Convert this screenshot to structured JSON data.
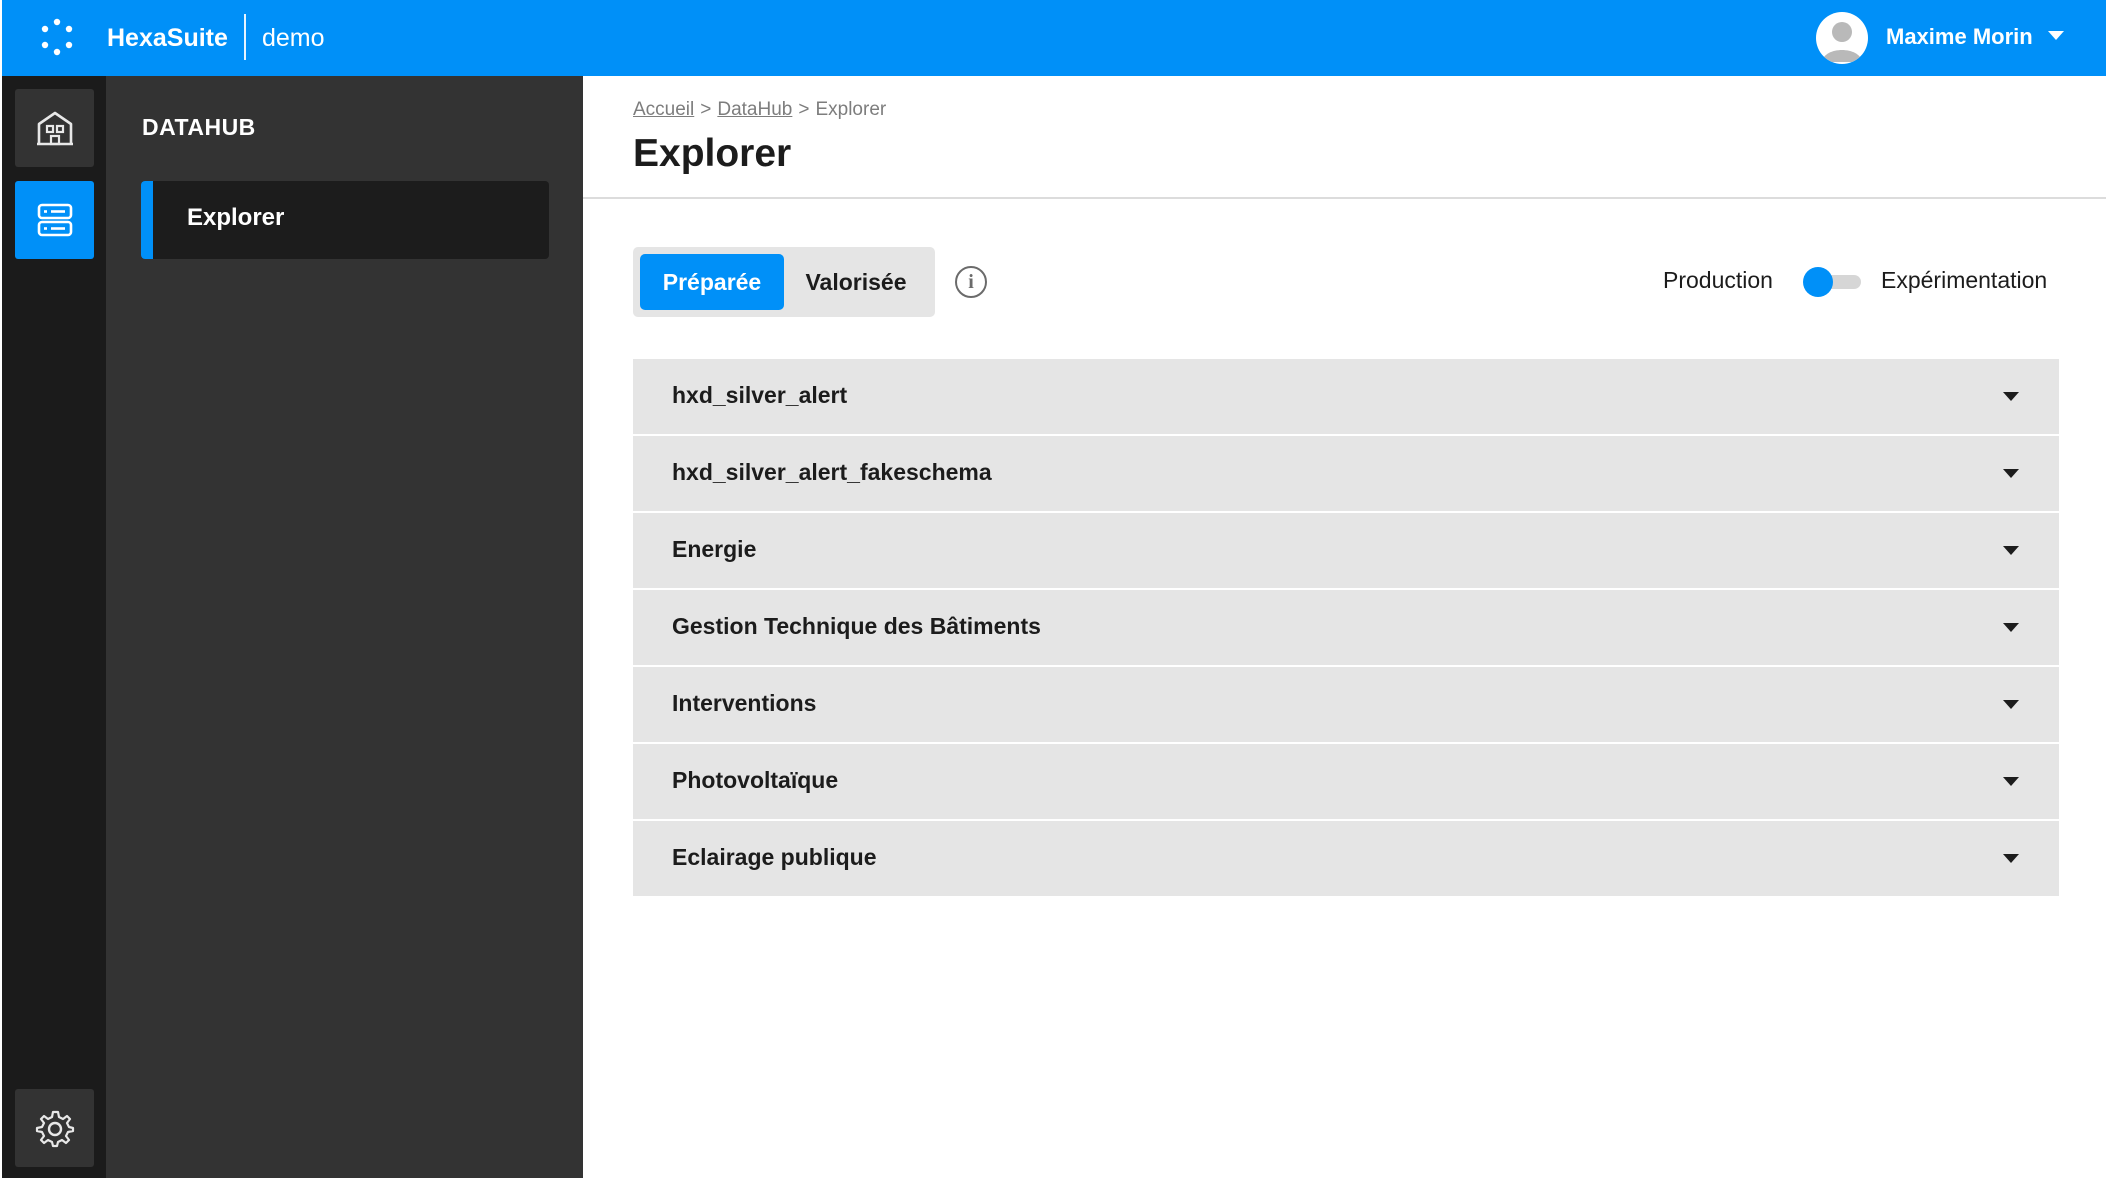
{
  "app": {
    "brand": "HexaSuite",
    "environment": "demo",
    "colors": {
      "primary": "#0090f8",
      "rail": "#1b1b1b",
      "sidebar": "#333333",
      "panel": "#e5e5e5"
    }
  },
  "user": {
    "name": "Maxime Morin"
  },
  "icons": {
    "logo": "dots-circle-icon",
    "rail_buildings": "building-icon",
    "rail_datahub": "server-stack-icon",
    "rail_settings": "gear-icon",
    "user_menu": "chevron-down-icon",
    "info": "info-circle-icon",
    "row_expand": "caret-down-icon"
  },
  "sidebar": {
    "section_title": "DATAHUB",
    "items": [
      {
        "label": "Explorer",
        "active": true
      }
    ]
  },
  "breadcrumb": {
    "items": [
      "Accueil",
      "DataHub"
    ],
    "current": "Explorer",
    "separator": ">"
  },
  "page": {
    "title": "Explorer"
  },
  "segmented": {
    "options": [
      "Préparée",
      "Valorisée"
    ],
    "selected": "Préparée"
  },
  "mode_toggle": {
    "left_label": "Production",
    "right_label": "Expérimentation",
    "state": "Production"
  },
  "datasets": [
    "hxd_silver_alert",
    "hxd_silver_alert_fakeschema",
    "Energie",
    "Gestion Technique des Bâtiments",
    "Interventions",
    "Photovoltaïque",
    "Eclairage publique"
  ]
}
